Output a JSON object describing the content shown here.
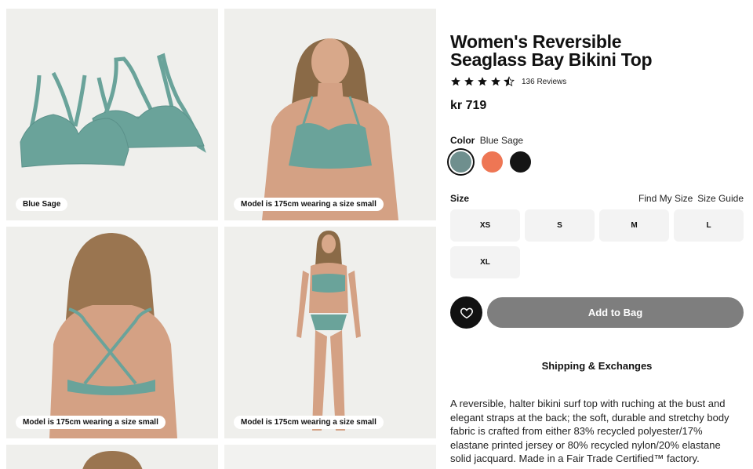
{
  "gallery": {
    "captions": [
      "Blue Sage",
      "Model is 175cm wearing a size small",
      "Model is 175cm wearing a size small",
      "Model is 175cm wearing a size small"
    ]
  },
  "product": {
    "title_line1": "Women's Reversible",
    "title_line2": "Seaglass Bay Bikini Top",
    "rating": 4.5,
    "reviews": "136 Reviews",
    "price": "kr 719",
    "color_label": "Color",
    "color_value": "Blue Sage",
    "swatches": [
      {
        "name": "Blue Sage",
        "color": "#6f8f8e",
        "selected": true
      },
      {
        "name": "coral",
        "color": "#ee7654",
        "selected": false
      },
      {
        "name": "black",
        "color": "#141414",
        "selected": false
      }
    ],
    "size_label": "Size",
    "find_my_size": "Find My Size",
    "size_guide": "Size Guide",
    "sizes": [
      "XS",
      "S",
      "M",
      "L",
      "XL"
    ],
    "add_to_bag": "Add to Bag",
    "wishlist_icon": "heart-icon",
    "shipping": "Shipping & Exchanges",
    "description": "A reversible, halter bikini surf top with ruching at the bust and elegant straps at the back; the soft, durable and stretchy body fabric is crafted from either 83% recycled polyester/17% elastane printed jersey or 80% recycled nylon/20% elastane solid jacquard. Made in a Fair Trade Certified™ factory."
  },
  "colors": {
    "tile_bg": "#efefec",
    "bikini": "#6aa39a",
    "add_button": "#7e7e7e"
  }
}
